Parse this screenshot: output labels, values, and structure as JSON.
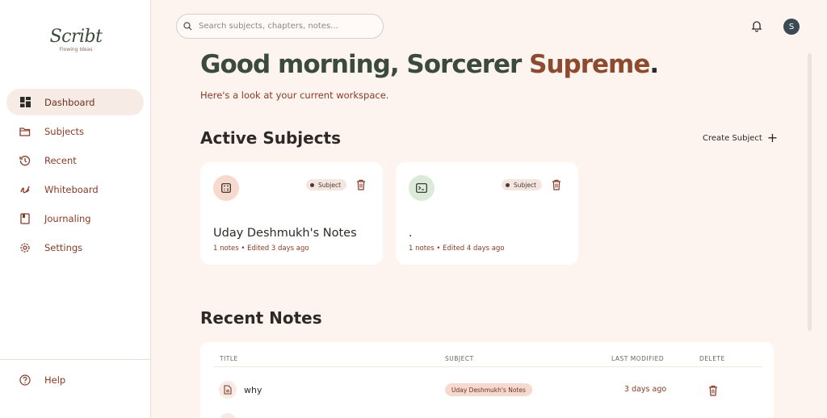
{
  "app": {
    "logo_text": "Scribt",
    "logo_tagline": "Flowing Ideas"
  },
  "sidebar": {
    "items": [
      {
        "label": "Dashboard",
        "icon": "dashboard-icon",
        "active": true
      },
      {
        "label": "Subjects",
        "icon": "folder-icon"
      },
      {
        "label": "Recent",
        "icon": "history-icon"
      },
      {
        "label": "Whiteboard",
        "icon": "pen-icon"
      },
      {
        "label": "Journaling",
        "icon": "book-icon"
      },
      {
        "label": "Settings",
        "icon": "gear-icon"
      }
    ],
    "help_label": "Help"
  },
  "topbar": {
    "search_placeholder": "Search subjects, chapters, notes...",
    "avatar_initial": "S"
  },
  "greeting": {
    "prefix": "Good morning, Sorcerer ",
    "name": "Supreme",
    "suffix": ".",
    "subtitle": "Here's a look at your current workspace."
  },
  "active_subjects": {
    "title": "Active Subjects",
    "create_label": "Create Subject",
    "cards": [
      {
        "title": "Uday Deshmukh's Notes",
        "meta": "1 notes • Edited 3 days ago",
        "badge": "Subject",
        "icon": "calculator-icon",
        "icon_bg": "#f8d9cd"
      },
      {
        "title": ".",
        "meta": "1 notes • Edited 4 days ago",
        "badge": "Subject",
        "icon": "terminal-icon",
        "icon_bg": "#dcebd9"
      }
    ]
  },
  "recent_notes": {
    "title": "Recent Notes",
    "columns": [
      "TITLE",
      "SUBJECT",
      "LAST MODIFIED",
      "DELETE"
    ],
    "rows": [
      {
        "title": "why",
        "subject": "Uday Deshmukh's Notes",
        "modified": "3 days ago"
      }
    ]
  },
  "colors": {
    "accent": "#8b3a25",
    "background": "#fdf3ef",
    "greeting_green": "#3a4a3d",
    "greeting_brown": "#8c4a2f"
  }
}
